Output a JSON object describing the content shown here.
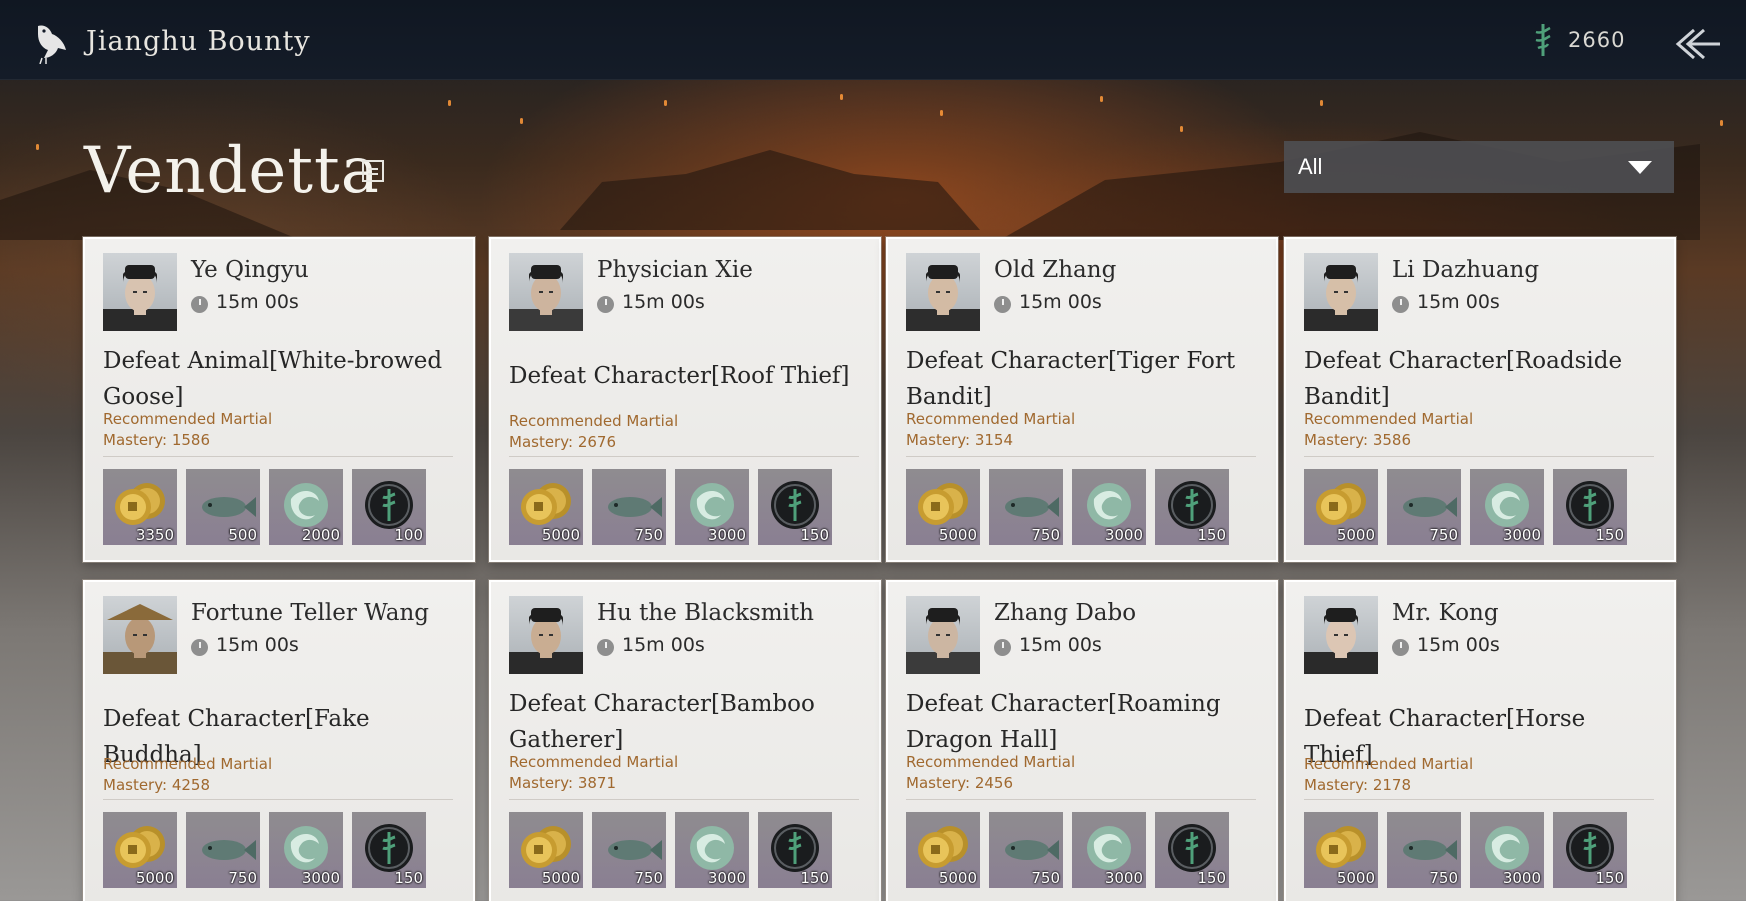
{
  "header": {
    "title": "Jianghu Bounty",
    "currency": "2660",
    "icons": {
      "logo": "bird-icon",
      "currency": "jade-token-icon",
      "back": "back-arrow-icon"
    }
  },
  "page": {
    "title": "Vendetta",
    "filter": {
      "selected": "All"
    }
  },
  "bounties": [
    {
      "name": "Ye Qingyu",
      "timer": "15m 00s",
      "quest": "Defeat Animal[White-browed Goose]",
      "rec_label": "Recommended Martial",
      "rec_value": "Mastery: 1586",
      "rewards": [
        "3350",
        "500",
        "2000",
        "100"
      ]
    },
    {
      "name": "Physician Xie",
      "timer": "15m 00s",
      "quest": "Defeat Character[Roof Thief]",
      "rec_label": "Recommended Martial",
      "rec_value": "Mastery: 2676",
      "rewards": [
        "5000",
        "750",
        "3000",
        "150"
      ]
    },
    {
      "name": "Old Zhang",
      "timer": "15m 00s",
      "quest": "Defeat Character[Tiger Fort Bandit]",
      "rec_label": "Recommended Martial",
      "rec_value": "Mastery: 3154",
      "rewards": [
        "5000",
        "750",
        "3000",
        "150"
      ]
    },
    {
      "name": "Li Dazhuang",
      "timer": "15m 00s",
      "quest": "Defeat Character[Roadside Bandit]",
      "rec_label": "Recommended Martial",
      "rec_value": "Mastery: 3586",
      "rewards": [
        "5000",
        "750",
        "3000",
        "150"
      ]
    },
    {
      "name": "Fortune Teller Wang",
      "timer": "15m 00s",
      "quest": "Defeat Character[Fake Buddha]",
      "rec_label": "Recommended Martial",
      "rec_value": "Mastery: 4258",
      "rewards": [
        "5000",
        "750",
        "3000",
        "150"
      ]
    },
    {
      "name": "Hu the Blacksmith",
      "timer": "15m 00s",
      "quest": "Defeat Character[Bamboo Gatherer]",
      "rec_label": "Recommended Martial",
      "rec_value": "Mastery: 3871",
      "rewards": [
        "5000",
        "750",
        "3000",
        "150"
      ]
    },
    {
      "name": "Zhang Dabo",
      "timer": "15m 00s",
      "quest": "Defeat Character[Roaming Dragon Hall]",
      "rec_label": "Recommended Martial",
      "rec_value": "Mastery: 2456",
      "rewards": [
        "5000",
        "750",
        "3000",
        "150"
      ]
    },
    {
      "name": "Mr. Kong",
      "timer": "15m 00s",
      "quest": "Defeat Character[Horse Thief]",
      "rec_label": "Recommended Martial",
      "rec_value": "Mastery: 2178",
      "rewards": [
        "5000",
        "750",
        "3000",
        "150"
      ]
    }
  ],
  "reward_icons": [
    "coin-stack-icon",
    "fish-icon",
    "jade-swirl-icon",
    "jade-token-icon"
  ],
  "colors": {
    "accent_text": "#a0692f",
    "currency_green": "#4fa07a"
  }
}
